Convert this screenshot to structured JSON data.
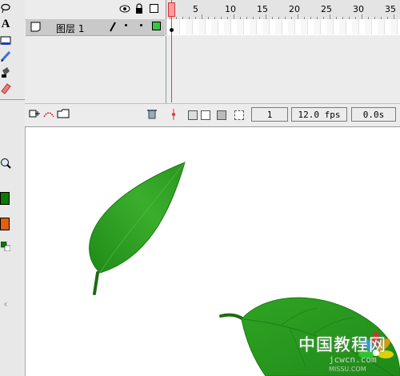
{
  "timeline": {
    "frame_numbers": [
      "1",
      "5",
      "10",
      "15",
      "20",
      "25",
      "30",
      "35"
    ],
    "layer_name": "图层 1",
    "current_frame": "1",
    "frame_rate": "12.0 fps",
    "elapsed_time": "0.0s"
  },
  "tools": {
    "items": [
      "lasso-icon",
      "text-icon",
      "rectangle-icon",
      "pencil-icon",
      "ink-bottle-icon",
      "eraser-icon",
      "zoom-icon",
      "stroke-color-icon",
      "fill-color-icon",
      "swap-colors-icon"
    ]
  },
  "watermark": {
    "title": "中国教程网",
    "url": "jcwcn.com",
    "sub": "MISSU.COM"
  },
  "colors": {
    "leaf": "#2e9a22",
    "leaf_light": "#49b83a",
    "stem": "#1e6b12",
    "playhead": "#e83b3b",
    "stroke_swatch": "#0a7a00",
    "fill_swatch": "#e06010"
  }
}
